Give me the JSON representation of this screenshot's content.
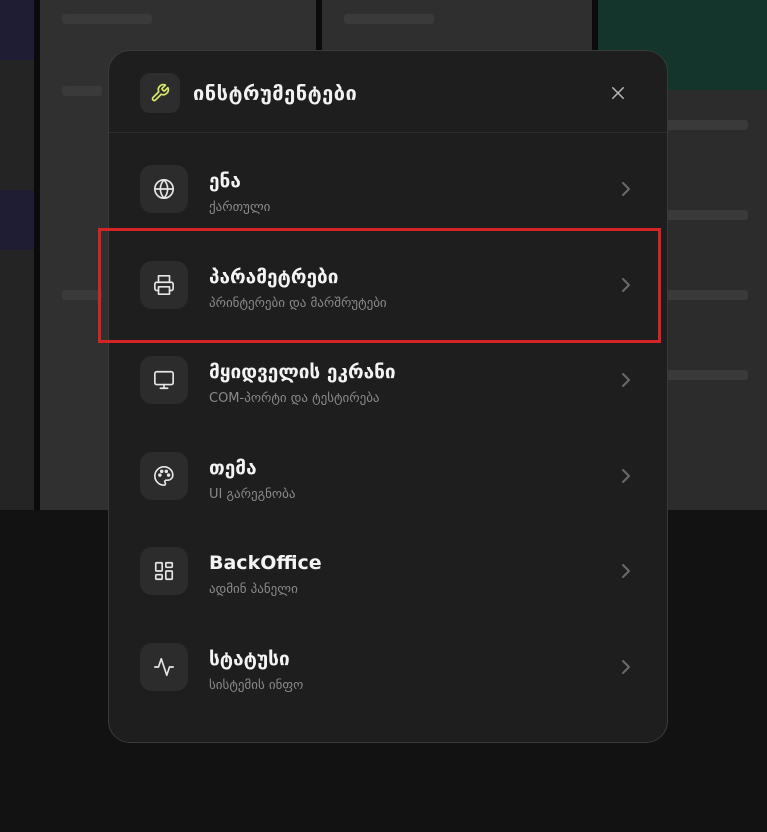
{
  "modal": {
    "title": "ინსტრუმენტები",
    "header_icon": "wrench-icon",
    "close_icon": "close-icon"
  },
  "menu": {
    "items": [
      {
        "title": "ენა",
        "subtitle": "ქართული",
        "icon": "globe-icon"
      },
      {
        "title": "პარამეტრები",
        "subtitle": "პრინტერები და მარშრუტები",
        "icon": "printer-icon"
      },
      {
        "title": "მყიდველის ეკრანი",
        "subtitle": "COM-პორტი და ტესტირება",
        "icon": "monitor-icon"
      },
      {
        "title": "თემა",
        "subtitle": "UI გარეგნობა",
        "icon": "palette-icon"
      },
      {
        "title": "BackOffice",
        "subtitle": "ადმინ პანელი",
        "icon": "dashboard-icon"
      },
      {
        "title": "სტატუსი",
        "subtitle": "სისტემის ინფო",
        "icon": "activity-icon"
      }
    ]
  },
  "colors": {
    "modal_bg": "#1e1e1e",
    "accent_icon": "#d9e86a",
    "highlight": "#d42424"
  }
}
